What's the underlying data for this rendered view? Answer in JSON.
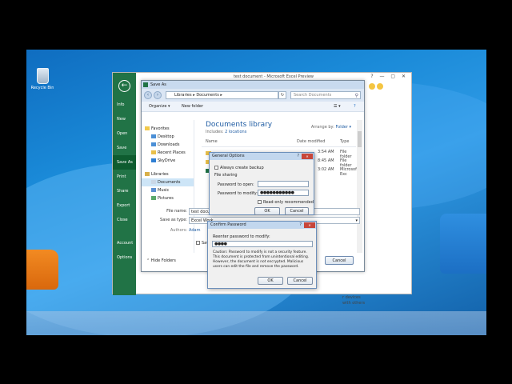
{
  "desktop": {
    "recycle_bin_label": "Recycle Bin"
  },
  "excel": {
    "title": "test document - Microsoft Excel Preview",
    "window_controls": "? — ▢ ✕",
    "backstage": {
      "back_glyph": "←",
      "items": [
        "Info",
        "New",
        "Open",
        "Save",
        "Save As",
        "Print",
        "Share",
        "Export",
        "Close",
        "Account",
        "Options"
      ],
      "selected": "Save As"
    },
    "behind_text": [
      "r devices",
      "with others"
    ]
  },
  "save_as": {
    "title": "Save As",
    "close_glyph": "✕",
    "address": [
      "Libraries",
      "Documents"
    ],
    "search_placeholder": "Search Documents",
    "refresh_glyph": "↻",
    "toolbar": {
      "organize": "Organize ▾",
      "new_folder": "New folder"
    },
    "tree": {
      "favorites_label": "Favorites",
      "favorites": [
        "Desktop",
        "Downloads",
        "Recent Places",
        "SkyDrive"
      ],
      "libraries_label": "Libraries",
      "libraries": [
        "Documents",
        "Music",
        "Pictures"
      ]
    },
    "library_title": "Documents library",
    "library_includes": "Includes:",
    "library_locations": "2 locations",
    "arrange_label": "Arrange by:",
    "arrange_value": "Folder ▾",
    "columns": {
      "name": "Name",
      "date": "Date modified",
      "type": "Type"
    },
    "rows": [
      {
        "date": "3:54 AM",
        "type": "File folder"
      },
      {
        "date": "8:45 AM",
        "type": "File folder"
      },
      {
        "date": "3:02 AM",
        "type": "Microsoft Exc"
      }
    ],
    "file_name_label": "File name:",
    "file_name_value": "test docum",
    "save_type_label": "Save as type:",
    "save_type_value": "Excel Work",
    "authors_label": "Authors:",
    "authors_value": "Adam",
    "save_thumb_fragment": "Sav",
    "hide_folders": "Hide Folders",
    "cancel": "Cancel"
  },
  "general_options": {
    "title": "General Options",
    "help_glyph": "?",
    "close_glyph": "✕",
    "always_backup": "Always create backup",
    "file_sharing": "File sharing",
    "password_open_label": "Password to open:",
    "password_modify_label": "Password to modify:",
    "password_modify_value": "●●●●●●●●●●●",
    "read_only": "Read-only recommended",
    "ok": "OK",
    "cancel": "Cancel"
  },
  "confirm_password": {
    "title": "Confirm Password",
    "help_glyph": "?",
    "close_glyph": "✕",
    "prompt": "Reenter password to modify:",
    "value": "●●●●",
    "caution": "Caution: Password to modify is not a security feature. This document is protected from unintentional editing. However, the document is not encrypted. Malicious users can edit the file and remove the password.",
    "ok": "OK",
    "cancel": "Cancel"
  }
}
